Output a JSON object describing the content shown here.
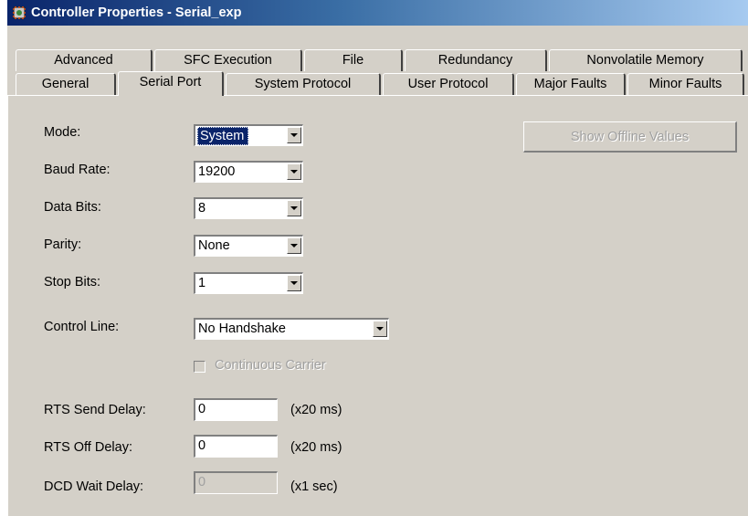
{
  "window": {
    "title": "Controller Properties - Serial_exp"
  },
  "tabs": {
    "row1": [
      "Advanced",
      "SFC Execution",
      "File",
      "Redundancy",
      "Nonvolatile Memory"
    ],
    "row2": [
      "General",
      "Serial Port",
      "System Protocol",
      "User Protocol",
      "Major Faults",
      "Minor Faults"
    ],
    "active": "Serial Port"
  },
  "form": {
    "mode_label": "Mode:",
    "mode_value": "System",
    "baud_label": "Baud Rate:",
    "baud_value": "19200",
    "databits_label": "Data Bits:",
    "databits_value": "8",
    "parity_label": "Parity:",
    "parity_value": "None",
    "stopbits_label": "Stop Bits:",
    "stopbits_value": "1",
    "controlline_label": "Control Line:",
    "controlline_value": "No Handshake",
    "continuous_carrier_label": "Continuous Carrier",
    "continuous_carrier_checked": false,
    "rts_send_label": "RTS Send Delay:",
    "rts_send_value": "0",
    "rts_send_unit": "(x20 ms)",
    "rts_off_label": "RTS Off Delay:",
    "rts_off_value": "0",
    "rts_off_unit": "(x20 ms)",
    "dcd_wait_label": "DCD Wait Delay:",
    "dcd_wait_value": "0",
    "dcd_wait_unit": "(x1 sec)"
  },
  "buttons": {
    "show_offline": "Show Offline Values"
  },
  "icons": {
    "title_icon": "controller-properties-icon"
  }
}
